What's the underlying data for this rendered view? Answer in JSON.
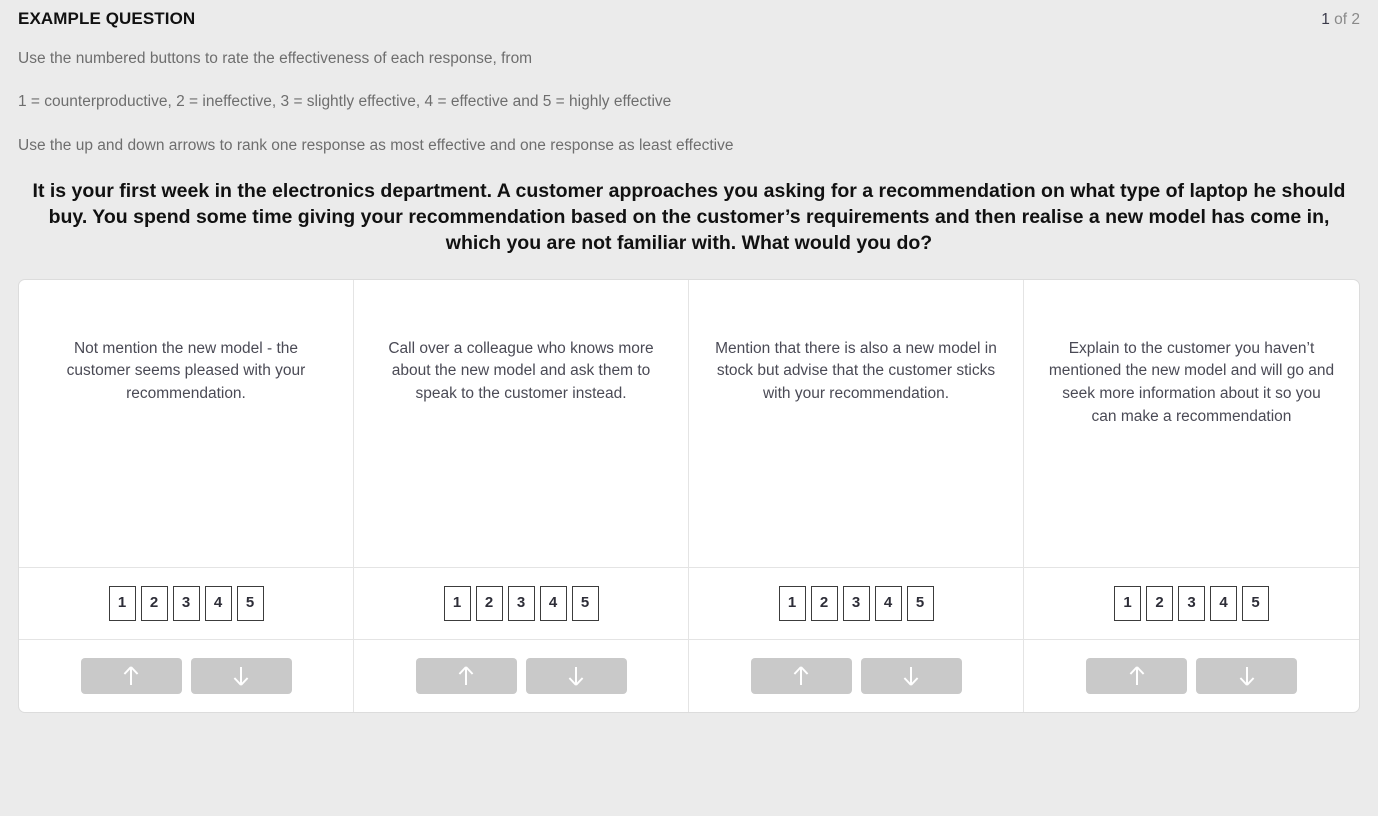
{
  "header": {
    "title": "EXAMPLE QUESTION",
    "counter_current": "1",
    "counter_rest": " of 2"
  },
  "instructions": [
    "Use the numbered buttons to rate the effectiveness of each response, from",
    "1 = counterproductive, 2 = ineffective, 3 = slightly effective, 4 = effective and 5 = highly effective",
    "Use the up and down arrows to rank one response as most effective and one response as least effective"
  ],
  "question": "It is your first week in the electronics department. A customer approaches you asking for a recommendation on what type of laptop he should buy. You spend some time giving your recommendation based on the customer’s requirements and then realise a new model has come in, which you are not familiar with. What would you do?",
  "rating_scale": [
    "1",
    "2",
    "3",
    "4",
    "5"
  ],
  "rank_buttons": {
    "up_icon": "arrow-up-icon",
    "down_icon": "arrow-down-icon"
  },
  "responses": [
    {
      "text": "Not mention the new model - the customer seems pleased with your recommendation."
    },
    {
      "text": "Call over a colleague who knows more about the new model and ask them to speak to the customer instead."
    },
    {
      "text": "Mention that there is also a new model in stock but advise that the customer sticks with your recommendation."
    },
    {
      "text": "Explain to the customer you haven’t mentioned the new model and will go and seek more information about it so you can make a recommendation"
    }
  ],
  "colors": {
    "page_background": "#ebebeb",
    "panel_background": "#ffffff",
    "grid_line": "#e4e4e4",
    "instruction_text": "#6e6e6e",
    "heading_text": "#111111",
    "response_text": "#4a4a55",
    "arrow_button": "#c9c9c9",
    "number_button_border": "#3c3c3c"
  }
}
